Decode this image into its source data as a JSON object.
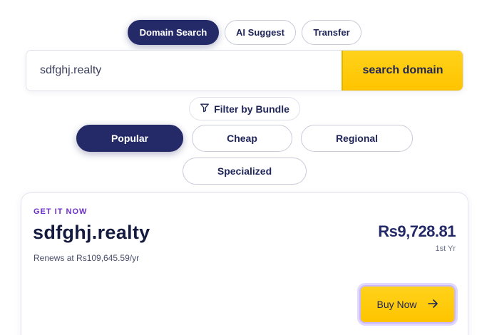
{
  "mode_tabs": [
    {
      "label": "Domain Search",
      "active": true
    },
    {
      "label": "AI Suggest",
      "active": false
    },
    {
      "label": "Transfer",
      "active": false
    }
  ],
  "search": {
    "value": "sdfghj.realty",
    "button_label": "search domain"
  },
  "filter": {
    "label": "Filter by Bundle",
    "icon": "filter-icon"
  },
  "bundles": [
    {
      "label": "Popular",
      "active": true
    },
    {
      "label": "Cheap",
      "active": false
    },
    {
      "label": "Regional",
      "active": false
    },
    {
      "label": "Specialized",
      "active": false
    }
  ],
  "result": {
    "eyebrow": "GET IT NOW",
    "domain": "sdfghj.realty",
    "renewal": "Renews at Rs109,645.59/yr",
    "price": "Rs9,728.81",
    "period": "1st Yr",
    "buy_label": "Buy Now",
    "buy_icon": "arrow-right-icon"
  },
  "colors": {
    "navy": "#242a67",
    "accent_yellow": "#ffc400",
    "eyebrow_purple": "#6b2fc9"
  }
}
